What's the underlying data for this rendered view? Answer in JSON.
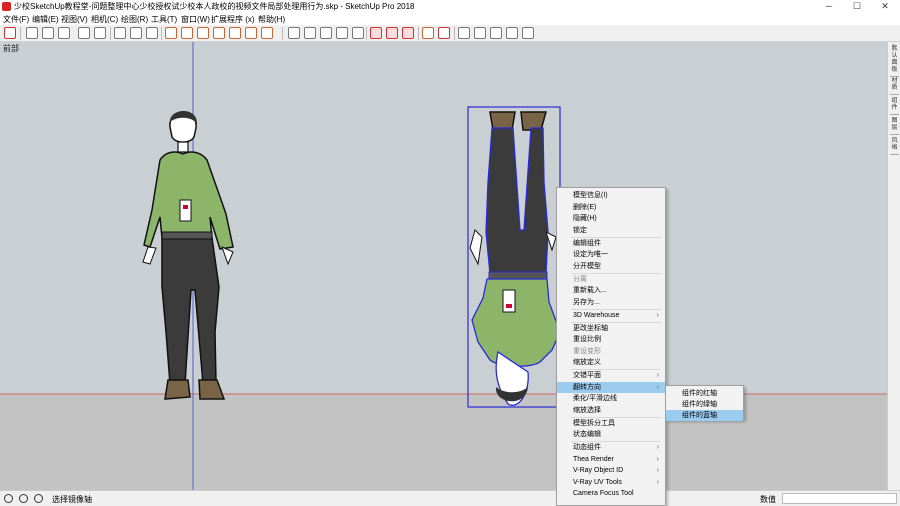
{
  "window": {
    "title": "少校SketchUp教程堂-问题整理中心少校授权试少校本人政校的视频文件局部处理用行为.skp - SketchUp Pro 2018",
    "controls": [
      "─",
      "☐",
      "✕"
    ]
  },
  "menubar": [
    "文件(F)",
    "编辑(E)",
    "视图(V)",
    "相机(C)",
    "绘图(R)",
    "工具(T)",
    "窗口(W)",
    "扩展程序 (x)",
    "帮助(H)"
  ],
  "viewport": {
    "scene_label": "前部"
  },
  "right_panel": {
    "tabs": [
      "默认面板",
      "材质",
      "组件",
      "图层",
      "风格"
    ]
  },
  "context_menu": {
    "items": [
      {
        "label": "模型信息(I)",
        "enabled": true,
        "submenu": false
      },
      {
        "label": "删除(E)",
        "enabled": true,
        "submenu": false
      },
      {
        "label": "隐藏(H)",
        "enabled": true,
        "submenu": false
      },
      {
        "label": "锁定",
        "enabled": true,
        "submenu": false,
        "divider_after": true
      },
      {
        "label": "编辑组件",
        "enabled": true,
        "submenu": false
      },
      {
        "label": "设定为唯一",
        "enabled": true,
        "submenu": false
      },
      {
        "label": "分开模型",
        "enabled": true,
        "submenu": false,
        "divider_after": true
      },
      {
        "label": "分离",
        "enabled": false,
        "submenu": false
      },
      {
        "label": "重新载入...",
        "enabled": true,
        "submenu": false
      },
      {
        "label": "另存为...",
        "enabled": true,
        "submenu": false,
        "divider_after": true
      },
      {
        "label": "3D Warehouse",
        "enabled": true,
        "submenu": true,
        "divider_after": true
      },
      {
        "label": "更改坐标轴",
        "enabled": true,
        "submenu": false
      },
      {
        "label": "重设比例",
        "enabled": true,
        "submenu": false
      },
      {
        "label": "重设变形",
        "enabled": false,
        "submenu": false
      },
      {
        "label": "缩放定义",
        "enabled": true,
        "submenu": false,
        "divider_after": true
      },
      {
        "label": "交错平面",
        "enabled": true,
        "submenu": true
      },
      {
        "label": "翻转方向",
        "enabled": true,
        "submenu": true,
        "highlighted": true
      },
      {
        "label": "柔化/平滑边线",
        "enabled": true,
        "submenu": false
      },
      {
        "label": "缩放选择",
        "enabled": true,
        "submenu": false,
        "divider_after": true
      },
      {
        "label": "模型拆分工具",
        "enabled": true,
        "submenu": false
      },
      {
        "label": "状态编辑",
        "enabled": true,
        "submenu": false,
        "divider_after": true
      },
      {
        "label": "动态组件",
        "enabled": true,
        "submenu": true
      },
      {
        "label": "Thea Render",
        "enabled": true,
        "submenu": true
      },
      {
        "label": "V-Ray Object ID",
        "enabled": true,
        "submenu": true
      },
      {
        "label": "V-Ray UV Tools",
        "enabled": true,
        "submenu": true
      },
      {
        "label": "Camera Focus Tool",
        "enabled": true,
        "submenu": false
      }
    ]
  },
  "submenu": {
    "items": [
      {
        "label": "组件的红轴",
        "highlighted": false
      },
      {
        "label": "组件的绿轴",
        "highlighted": false
      },
      {
        "label": "组件的蓝轴",
        "highlighted": true
      }
    ]
  },
  "statusbar": {
    "text": "选择镜像轴",
    "measure_label": "数值",
    "measure_value": ""
  },
  "colors": {
    "viewport_bg": "#c9cfd3",
    "ground": "#c3c3c3",
    "shirt": "#8db56a",
    "trousers": "#3b3b3b",
    "selection": "#2a2ad8",
    "menu_highlight": "#9ccbf0"
  }
}
